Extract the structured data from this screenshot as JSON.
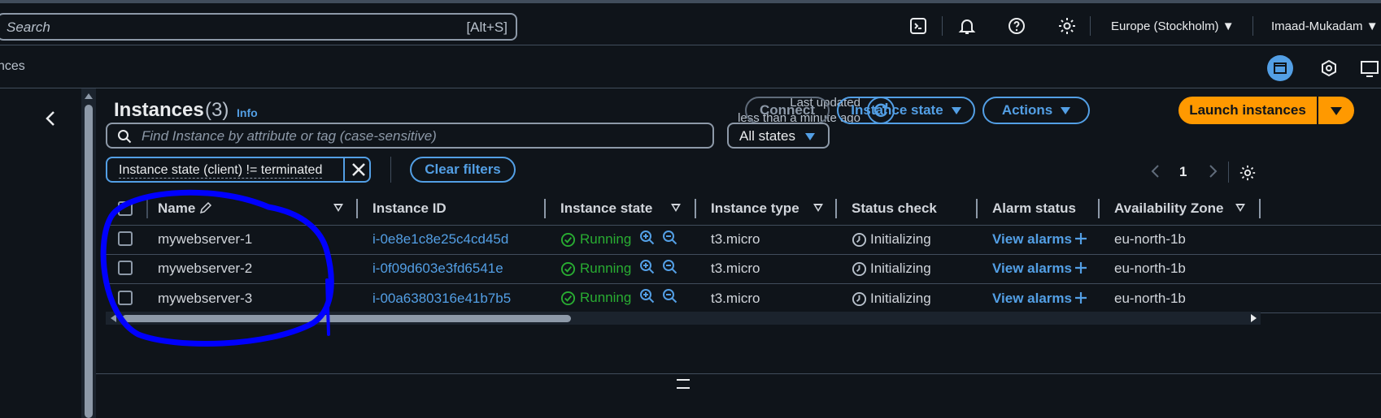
{
  "topbar": {
    "search_placeholder": "Search",
    "search_shortcut": "[Alt+S]",
    "region": "Europe (Stockholm)",
    "user": "Imaad-Mukadam"
  },
  "subbar": {
    "breadcrumb": "nces"
  },
  "header": {
    "title": "Instances",
    "count": "(3)",
    "info": "Info",
    "updated_line1": "Last updated",
    "updated_line2": "less than a minute ago",
    "connect": "Connect",
    "instance_state": "Instance state",
    "actions": "Actions",
    "launch": "Launch instances"
  },
  "filters": {
    "find_placeholder": "Find Instance by attribute or tag (case-sensitive)",
    "states_select": "All states",
    "token": "Instance state (client) != terminated",
    "clear": "Clear filters"
  },
  "pagination": {
    "page": "1"
  },
  "table": {
    "columns": [
      "Name",
      "Instance ID",
      "Instance state",
      "Instance type",
      "Status check",
      "Alarm status",
      "Availability Zone"
    ],
    "rows": [
      {
        "name": "mywebserver-1",
        "id": "i-0e8e1c8e25c4cd45d",
        "state": "Running",
        "type": "t3.micro",
        "status": "Initializing",
        "alarm": "View alarms",
        "az": "eu-north-1b"
      },
      {
        "name": "mywebserver-2",
        "id": "i-0f09d603e3fd6541e",
        "state": "Running",
        "type": "t3.micro",
        "status": "Initializing",
        "alarm": "View alarms",
        "az": "eu-north-1b"
      },
      {
        "name": "mywebserver-3",
        "id": "i-00a6380316e41b7b5",
        "state": "Running",
        "type": "t3.micro",
        "status": "Initializing",
        "alarm": "View alarms",
        "az": "eu-north-1b"
      }
    ]
  },
  "colors": {
    "accent": "#539fe5",
    "launch": "#ff9900",
    "running": "#29ad32",
    "annotation": "#0000ff"
  }
}
